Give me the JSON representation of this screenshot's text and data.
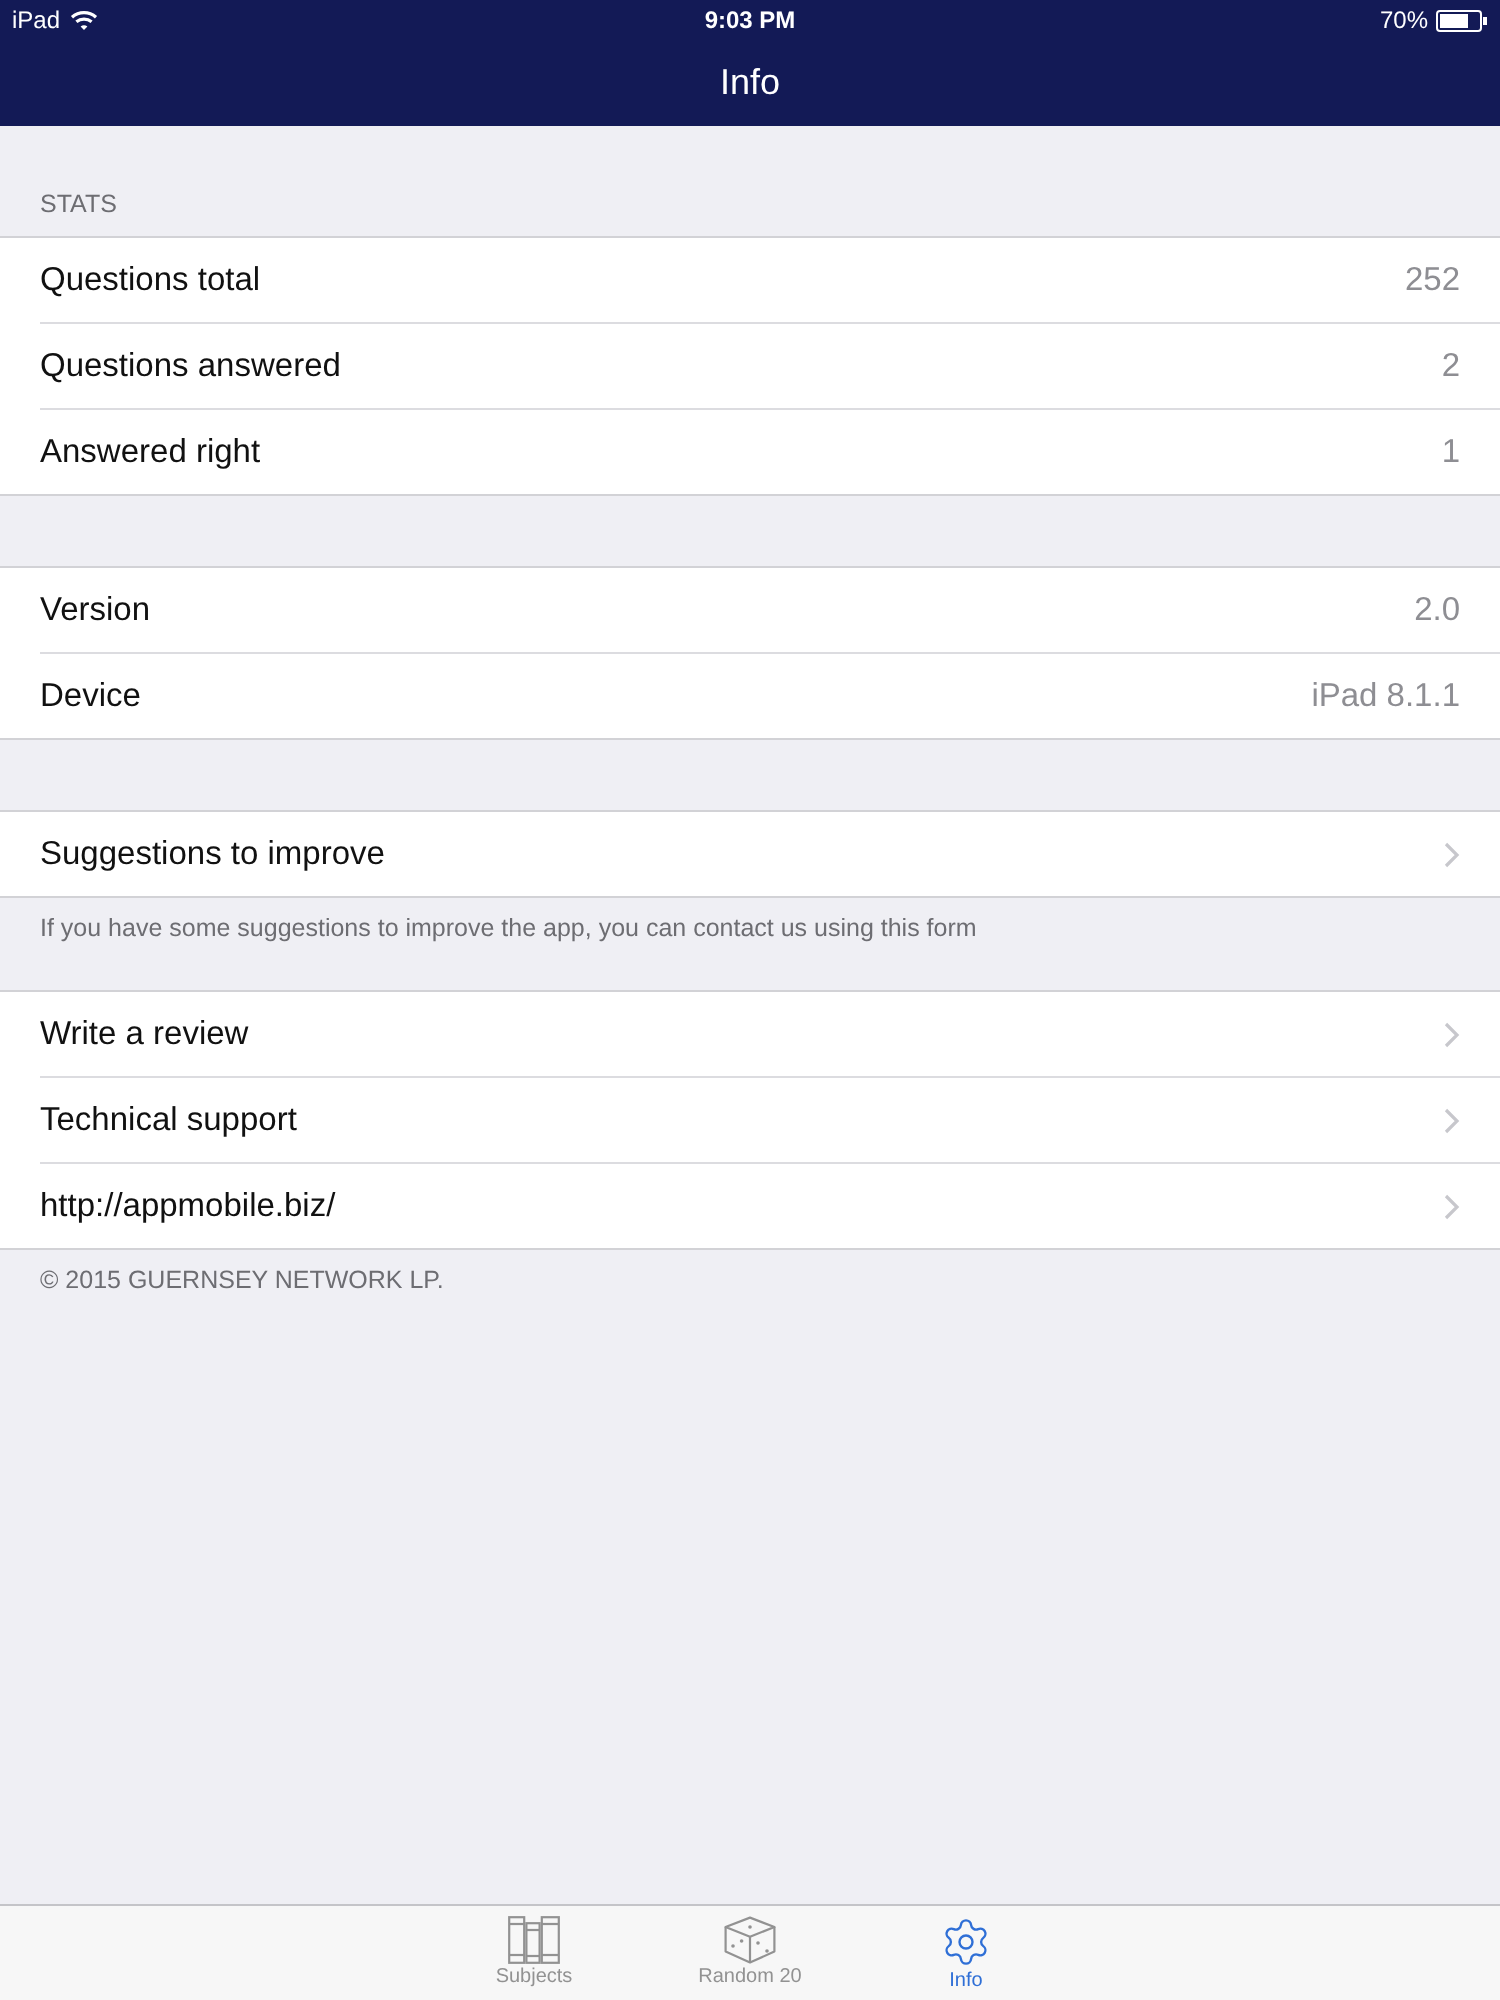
{
  "status_bar": {
    "device": "iPad",
    "time": "9:03 PM",
    "battery": "70%"
  },
  "nav_bar": {
    "title": "Info"
  },
  "sections": [
    {
      "header": "STATS",
      "rows": [
        {
          "kind": "value",
          "label": "Questions total",
          "value": "252"
        },
        {
          "kind": "value",
          "label": "Questions answered",
          "value": "2"
        },
        {
          "kind": "value",
          "label": "Answered right",
          "value": "1"
        }
      ]
    },
    {
      "rows": [
        {
          "kind": "value",
          "label": "Version",
          "value": "2.0"
        },
        {
          "kind": "value",
          "label": "Device",
          "value": "iPad 8.1.1"
        }
      ]
    },
    {
      "rows": [
        {
          "kind": "link",
          "label": "Suggestions to improve"
        }
      ],
      "footer": "If you have some suggestions to improve the app, you can contact us using this form"
    },
    {
      "rows": [
        {
          "kind": "link",
          "label": "Write a review"
        },
        {
          "kind": "link",
          "label": "Technical support"
        },
        {
          "kind": "link",
          "label": "http://appmobile.biz/"
        }
      ],
      "footer": "© 2015 GUERNSEY NETWORK LP."
    }
  ],
  "tab_bar": {
    "items": [
      {
        "label": "Subjects",
        "selected": false
      },
      {
        "label": "Random 20",
        "selected": false
      },
      {
        "label": "Info",
        "selected": true
      }
    ]
  }
}
